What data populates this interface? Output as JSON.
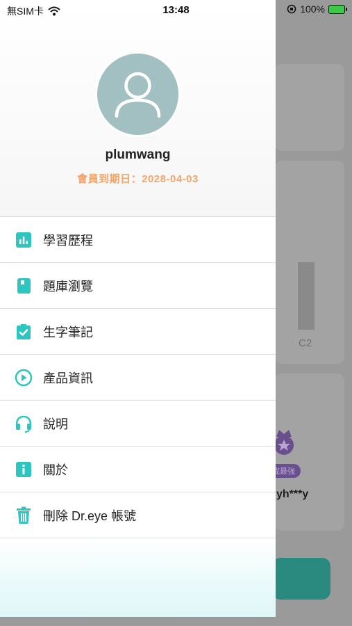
{
  "status_bar": {
    "carrier": "無SIM卡",
    "time": "13:48",
    "battery": "100%",
    "icons": [
      "wifi-icon",
      "orientation-lock-icon",
      "battery-charging-icon"
    ]
  },
  "profile": {
    "username": "plumwang",
    "expiry": "會員到期日：2028-04-03",
    "avatar_icon": "user-avatar-icon"
  },
  "menu": {
    "items": [
      {
        "label": "學習歷程",
        "icon": "bar-chart-icon"
      },
      {
        "label": "題庫瀏覽",
        "icon": "book-icon"
      },
      {
        "label": "生字筆記",
        "icon": "clipboard-check-icon"
      },
      {
        "label": "產品資訊",
        "icon": "play-circle-icon"
      },
      {
        "label": "說明",
        "icon": "headset-icon"
      },
      {
        "label": "關於",
        "icon": "info-icon"
      },
      {
        "label": "刪除 Dr.eye 帳號",
        "icon": "trash-icon"
      }
    ]
  },
  "background": {
    "chart_label": "C2",
    "badge_text": "我最強",
    "leader_name": "yh***y"
  },
  "colors": {
    "accent": "#2ec4c0",
    "expiry": "#f2a46a",
    "avatar_bg": "#a2bfc1"
  }
}
